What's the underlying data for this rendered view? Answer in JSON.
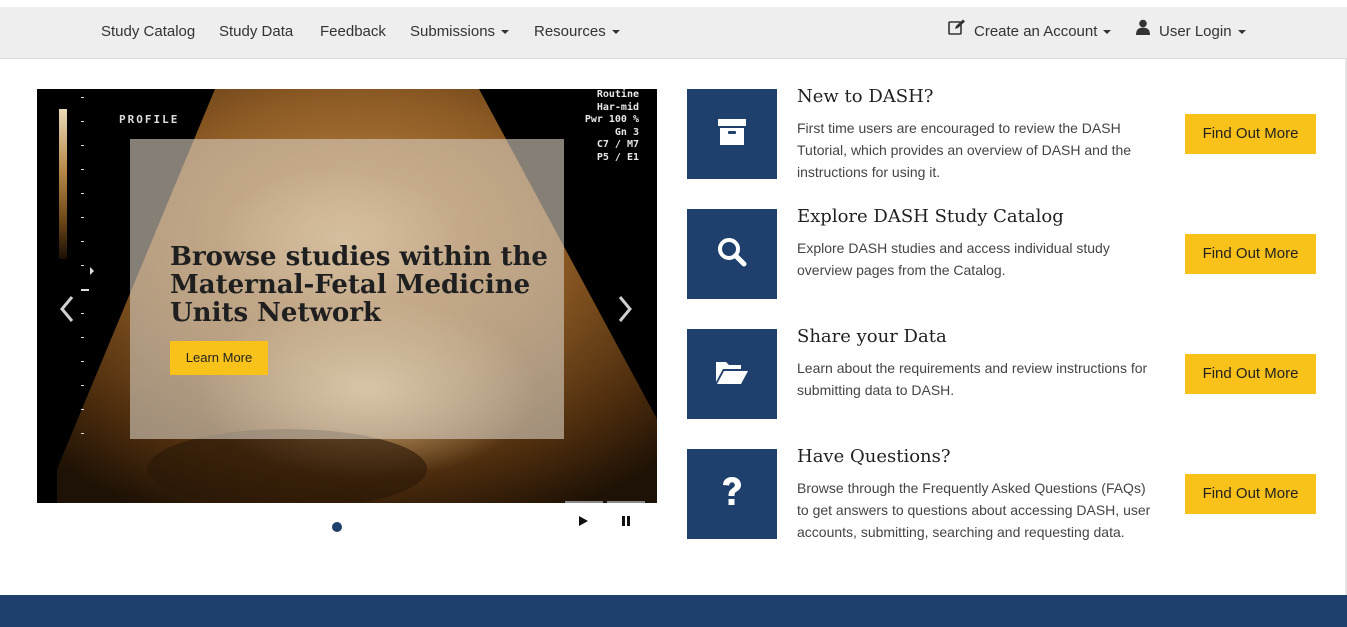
{
  "nav": {
    "items": [
      {
        "label": "Study Catalog"
      },
      {
        "label": "Study Data"
      },
      {
        "label": "Feedback"
      },
      {
        "label": "Submissions"
      },
      {
        "label": "Resources"
      }
    ],
    "create_account": {
      "label": "Create an Account",
      "icon": "edit-icon"
    },
    "user_login": {
      "label": "User Login",
      "icon": "user-icon"
    }
  },
  "carousel": {
    "image_overlay": {
      "profile": "PROFILE",
      "params": [
        "Routine",
        "Har-mid",
        "Pwr 100 %",
        "Gn  3",
        "C7 / M7",
        "P5 / E1"
      ]
    },
    "slide": {
      "title": "Browse studies within the Maternal-Fetal Medicine Units Network",
      "button": "Learn More"
    },
    "controls": {
      "prev": "chevron-left-icon",
      "next": "chevron-right-icon",
      "play": "play-icon",
      "pause": "pause-icon"
    }
  },
  "features": [
    {
      "title": "New to DASH?",
      "description": "First time users are encouraged to review the DASH Tutorial, which provides an overview of DASH and the instructions for using it.",
      "button": "Find Out More",
      "icon": "archive-box-icon"
    },
    {
      "title": "Explore DASH Study Catalog",
      "description": "Explore DASH studies and access individual study overview pages from the Catalog.",
      "button": "Find Out More",
      "icon": "search-icon"
    },
    {
      "title": "Share your Data",
      "description": "Learn about the requirements and review instructions for submitting data to DASH.",
      "button": "Find Out More",
      "icon": "folder-open-icon"
    },
    {
      "title": "Have Questions?",
      "description": "Browse through the Frequently Asked Questions (FAQs) to get answers to questions about accessing DASH, user accounts, submitting, searching and requesting data.",
      "button": "Find Out More",
      "icon": "question-icon"
    }
  ],
  "colors": {
    "navy": "#1f3f6c",
    "accent_yellow": "#f8c21a",
    "nav_bg": "#eeeeee"
  }
}
